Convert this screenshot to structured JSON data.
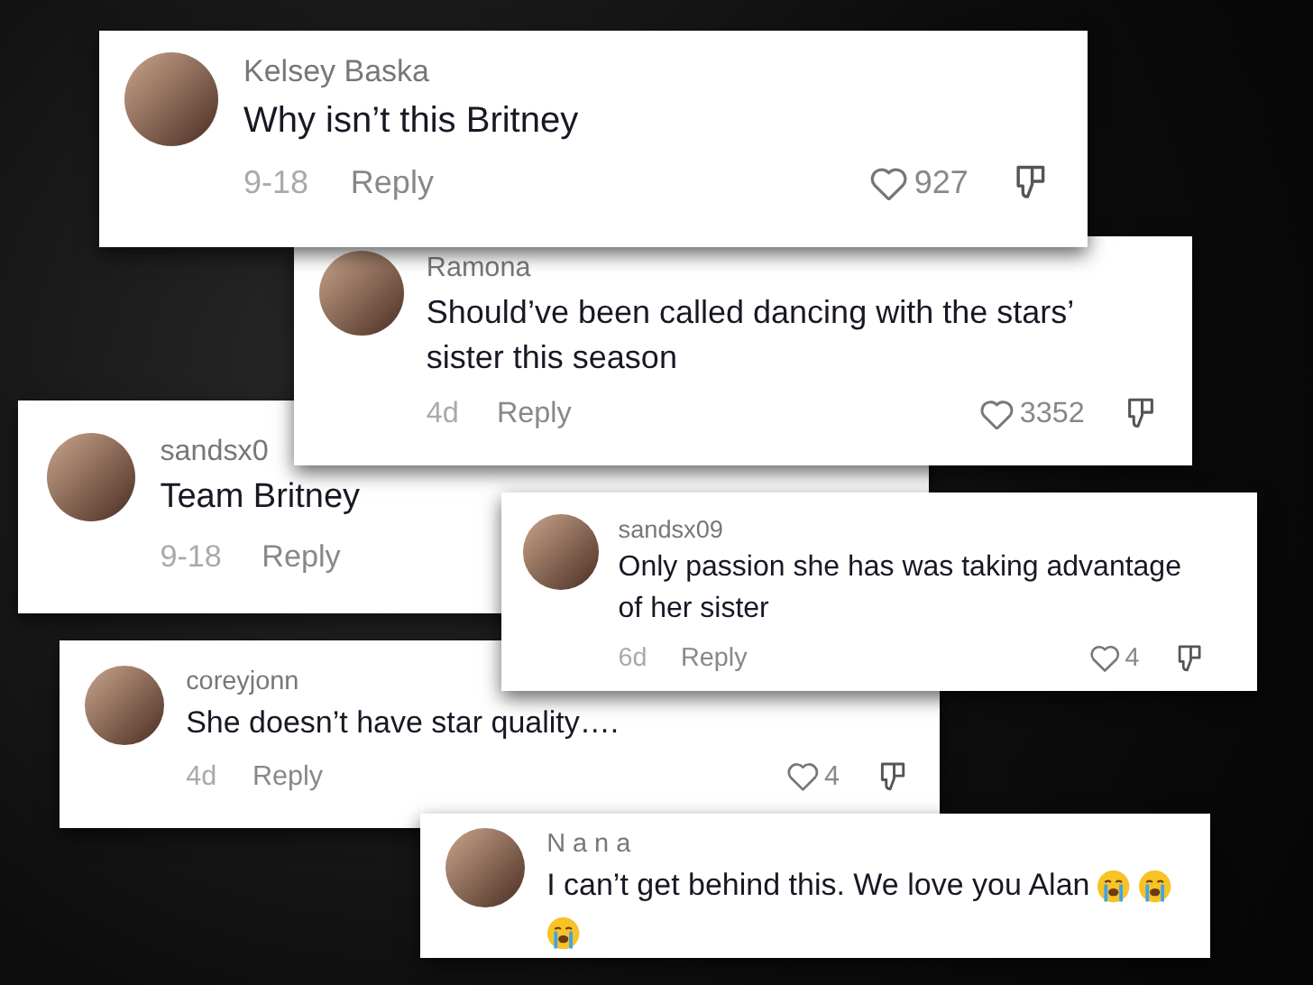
{
  "comments": [
    {
      "username": "Kelsey Baska",
      "text": "Why isn’t this Britney",
      "date": "9-18",
      "reply": "Reply",
      "likes": "927"
    },
    {
      "username": "Ramona",
      "text": "Should’ve been called dancing with the stars’ sister this season",
      "date": "4d",
      "reply": "Reply",
      "likes": "3352"
    },
    {
      "username": "sandsx0",
      "text": "Team Britney",
      "date": "9-18",
      "reply": "Reply"
    },
    {
      "username": "sandsx09",
      "text": "Only passion she has was taking advantage of her sister",
      "date": "6d",
      "reply": "Reply",
      "likes": "4"
    },
    {
      "username": "coreyjonn",
      "text": "She doesn’t have star quality….",
      "date": "4d",
      "reply": "Reply",
      "likes": "4"
    },
    {
      "username": "N a n a",
      "text": "I can’t get behind this. We love you Alan",
      "emojis": [
        {
          "kind": "crying"
        },
        {
          "kind": "crying"
        },
        {
          "kind": "crying"
        }
      ]
    }
  ]
}
